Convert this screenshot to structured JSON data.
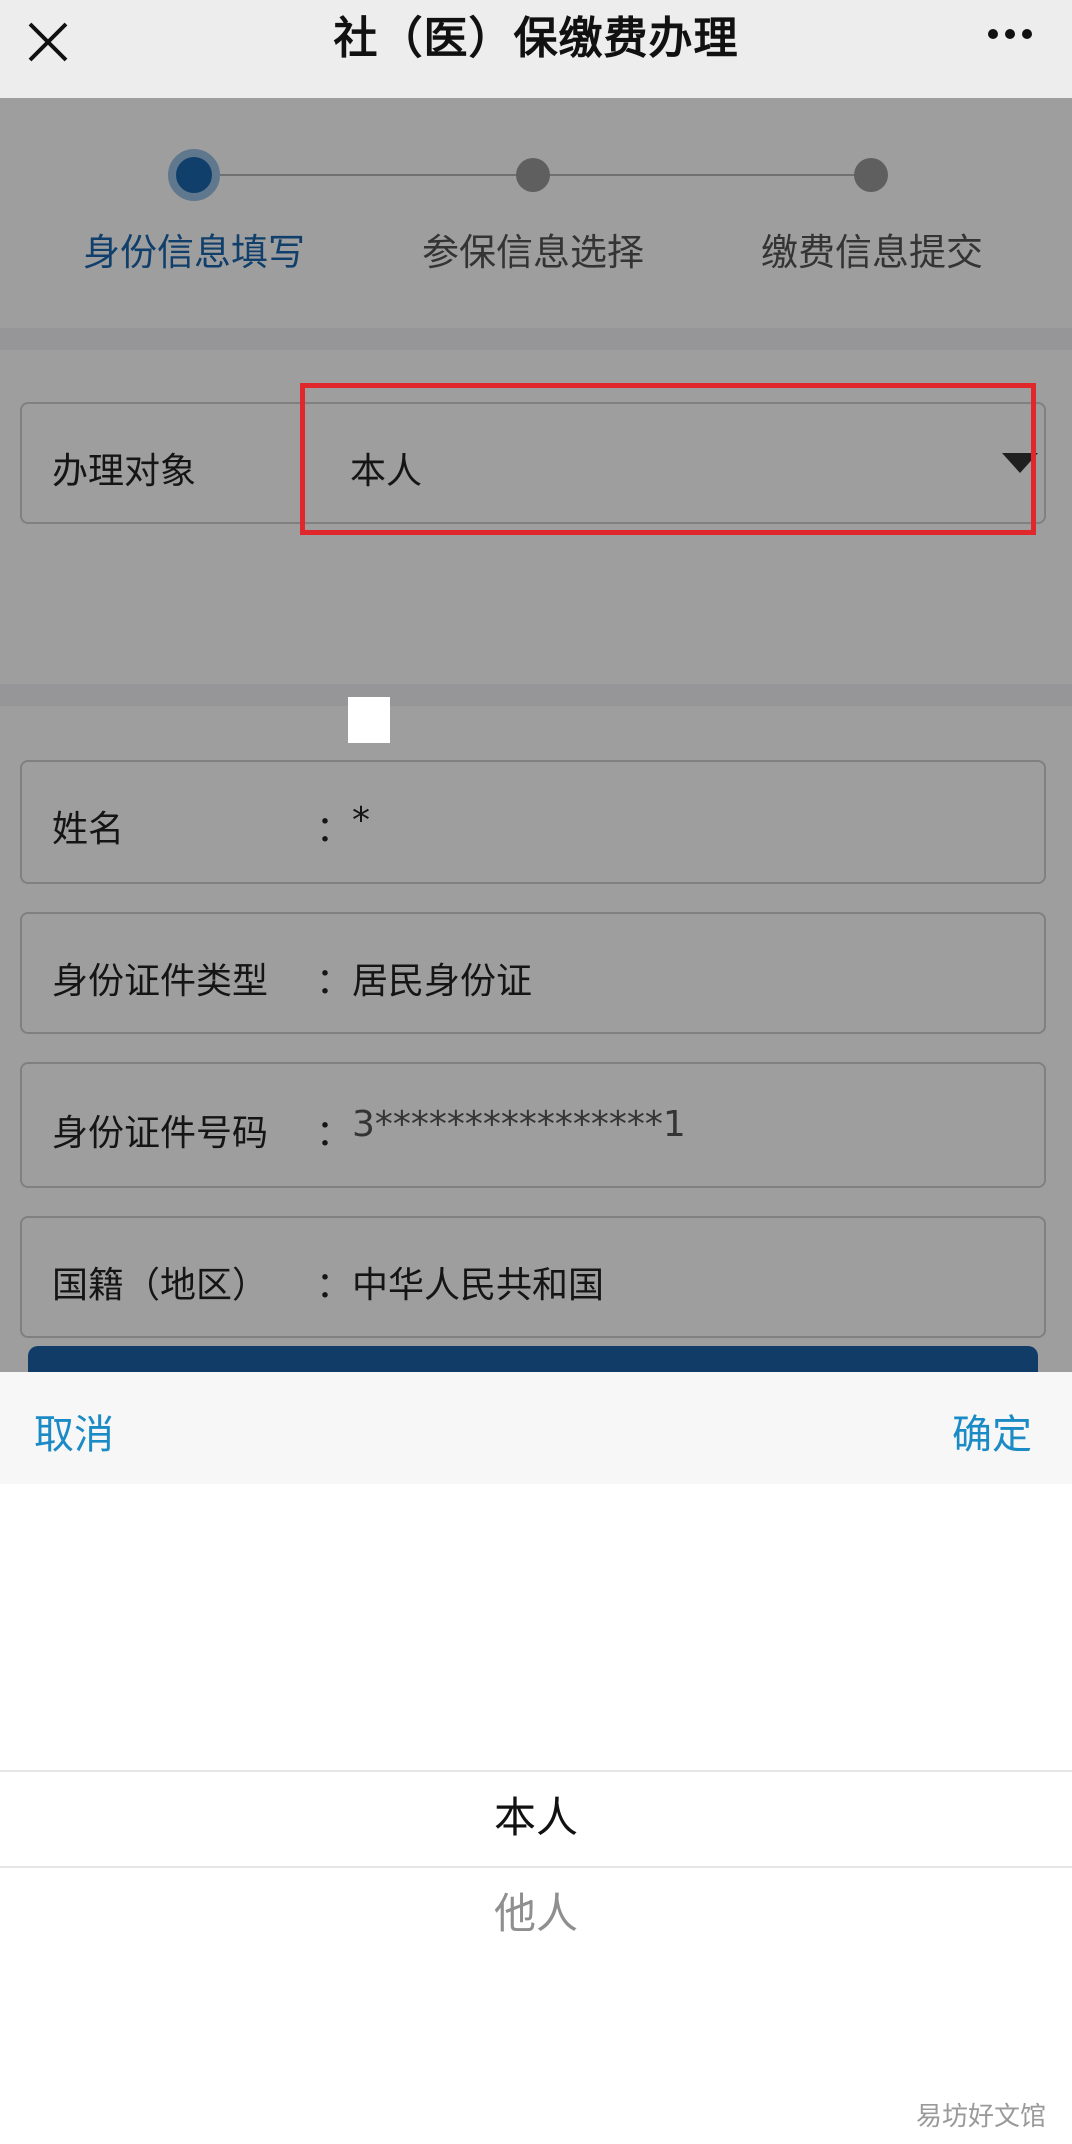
{
  "navbar": {
    "title": "社（医）保缴费办理",
    "close_icon": "close-icon",
    "more_icon": "more-dots-icon"
  },
  "steps": [
    {
      "label": "身份信息填写",
      "active": true
    },
    {
      "label": "参保信息选择",
      "active": false
    },
    {
      "label": "缴费信息提交",
      "active": false
    }
  ],
  "form": {
    "target": {
      "label": "办理对象",
      "value": "本人"
    },
    "name": {
      "label": "姓名",
      "colon": "：",
      "value": "*"
    },
    "id_type": {
      "label": "身份证件类型",
      "colon": "：",
      "value": "居民身份证"
    },
    "id_number": {
      "label": "身份证件号码",
      "colon": "：",
      "value": "3****************1"
    },
    "nationality": {
      "label": "国籍（地区）",
      "colon": "：",
      "value": "中华人民共和国"
    }
  },
  "picker": {
    "cancel_label": "取消",
    "confirm_label": "确定",
    "options": [
      "本人",
      "他人"
    ],
    "selected": "本人"
  },
  "watermark": "易坊好文馆",
  "colors": {
    "accent": "#1a66ad",
    "picker_action": "#1b8bc6",
    "highlight": "#e0282c"
  }
}
